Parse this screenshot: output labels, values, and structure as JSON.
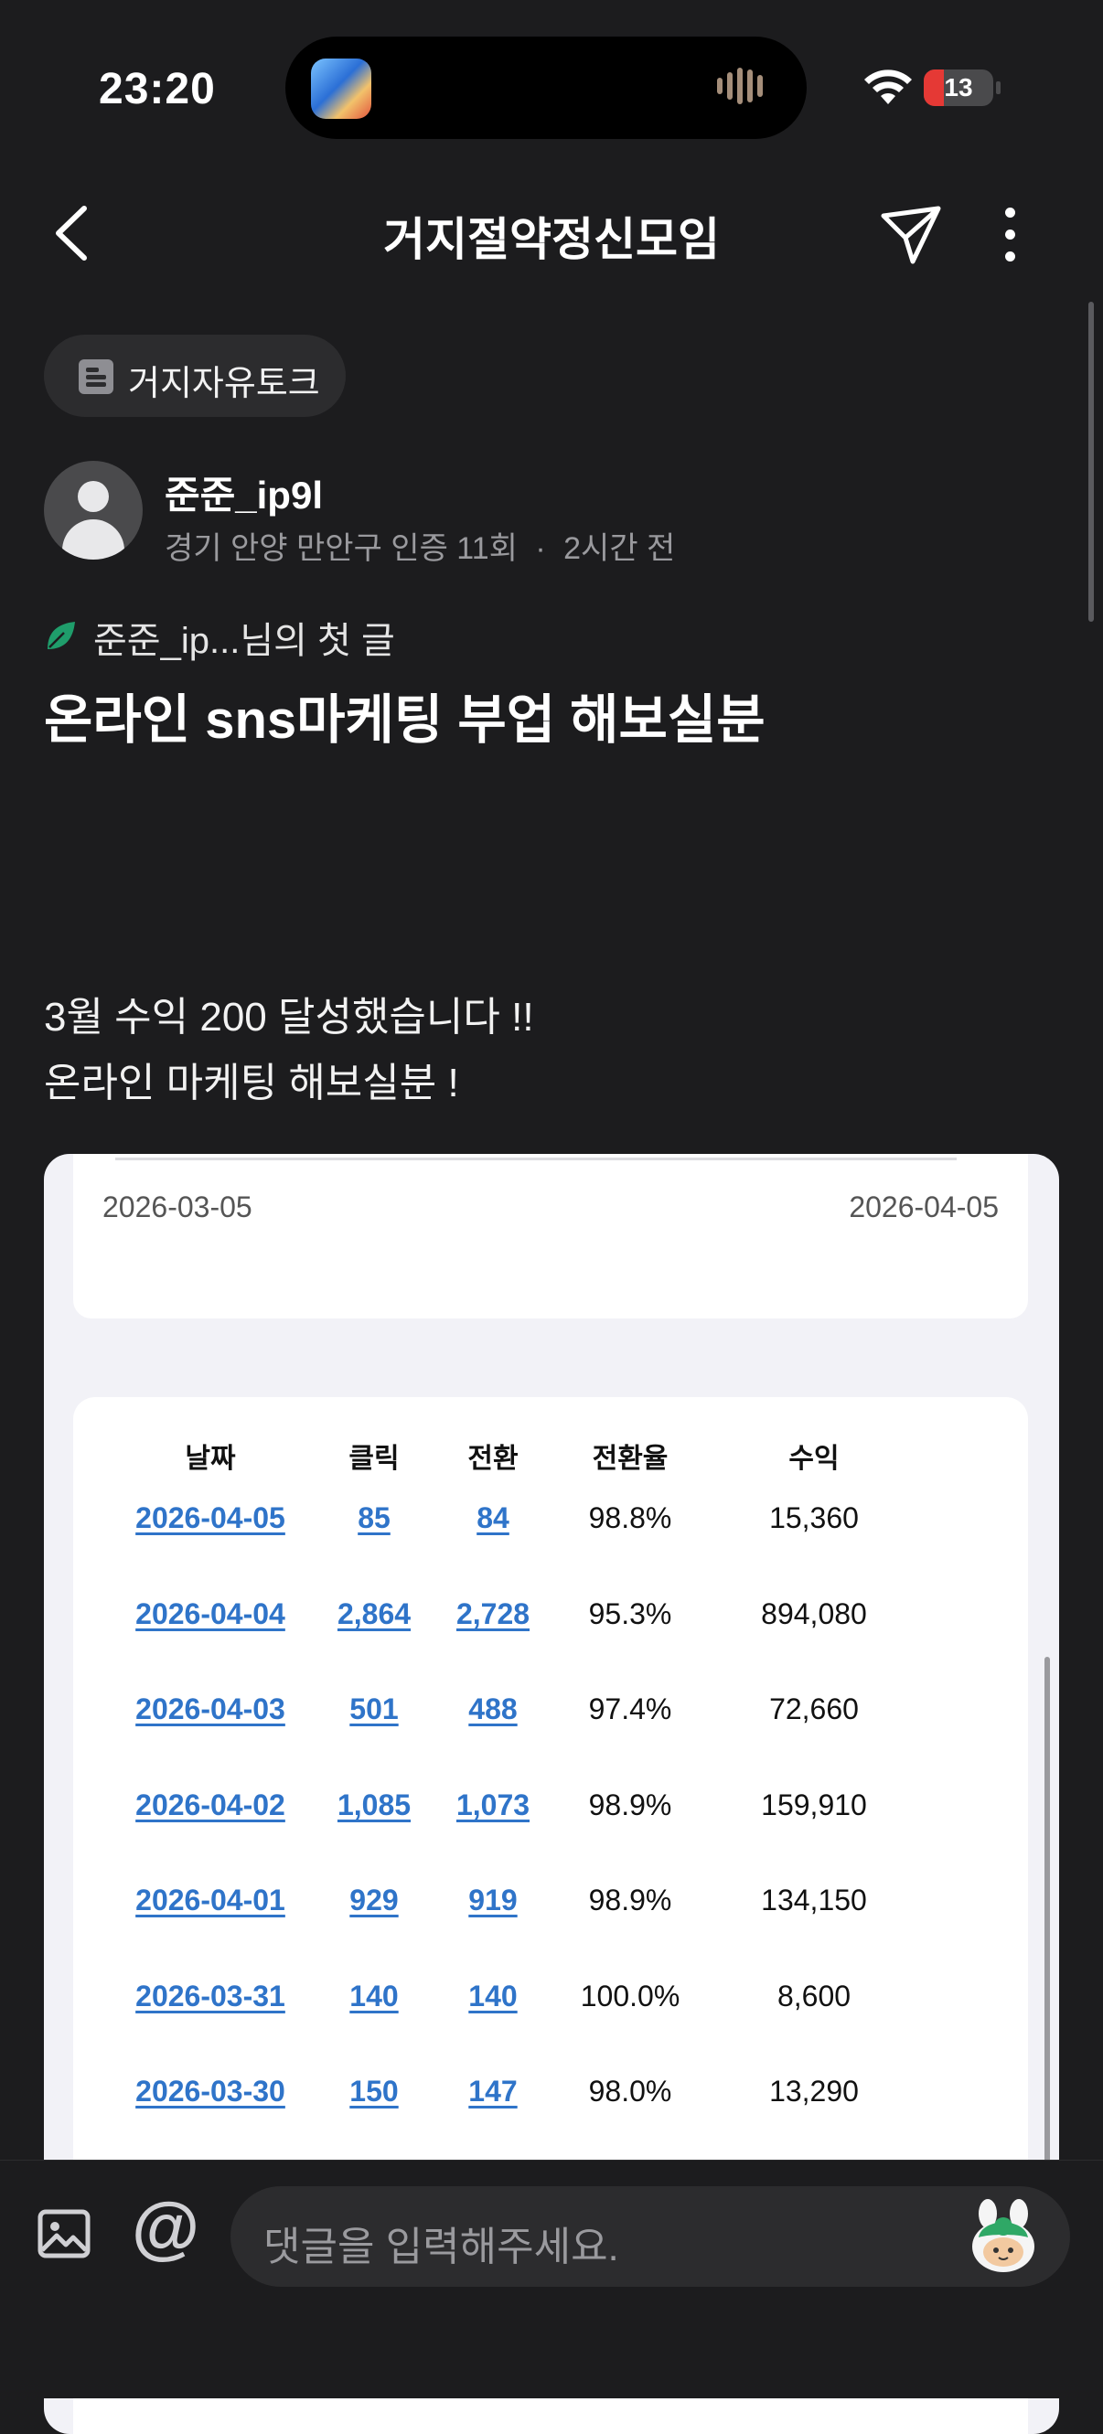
{
  "status_bar": {
    "time": "23:20",
    "battery": "13"
  },
  "nav": {
    "title": "거지절약정신모임"
  },
  "board": {
    "label": "거지자유토크"
  },
  "author": {
    "name": "준준_ip9l",
    "location": "경기 안양 만안구 인증 11회",
    "separator": "·",
    "time_ago": "2시간 전"
  },
  "first_post": "준준_ip...님의 첫 글",
  "post": {
    "title": "온라인 sns마케팅 부업 해보실분",
    "line1": "3월 수익 200 달성했습니다 !!",
    "line2": "온라인 마케팅 해보실분 !"
  },
  "screenshot": {
    "date_from": "2026-03-05",
    "date_to": "2026-04-05",
    "headers": {
      "date": "날짜",
      "clicks": "클릭",
      "conversions": "전환",
      "rate": "전환율",
      "revenue": "수익"
    },
    "rows": [
      {
        "date": "2026-04-05",
        "clicks": "85",
        "conversions": "84",
        "rate": "98.8%",
        "revenue": "15,360"
      },
      {
        "date": "2026-04-04",
        "clicks": "2,864",
        "conversions": "2,728",
        "rate": "95.3%",
        "revenue": "894,080"
      },
      {
        "date": "2026-04-03",
        "clicks": "501",
        "conversions": "488",
        "rate": "97.4%",
        "revenue": "72,660"
      },
      {
        "date": "2026-04-02",
        "clicks": "1,085",
        "conversions": "1,073",
        "rate": "98.9%",
        "revenue": "159,910"
      },
      {
        "date": "2026-04-01",
        "clicks": "929",
        "conversions": "919",
        "rate": "98.9%",
        "revenue": "134,150"
      },
      {
        "date": "2026-03-31",
        "clicks": "140",
        "conversions": "140",
        "rate": "100.0%",
        "revenue": "8,600"
      },
      {
        "date": "2026-03-30",
        "clicks": "150",
        "conversions": "147",
        "rate": "98.0%",
        "revenue": "13,290"
      }
    ]
  },
  "comment_bar": {
    "at_symbol": "@",
    "placeholder": "댓글을 입력해주세요."
  },
  "colors": {
    "background": "#1c1c1e",
    "link": "#2f74c9",
    "accent_green": "#1f9d6b",
    "battery_low": "#e53935"
  }
}
